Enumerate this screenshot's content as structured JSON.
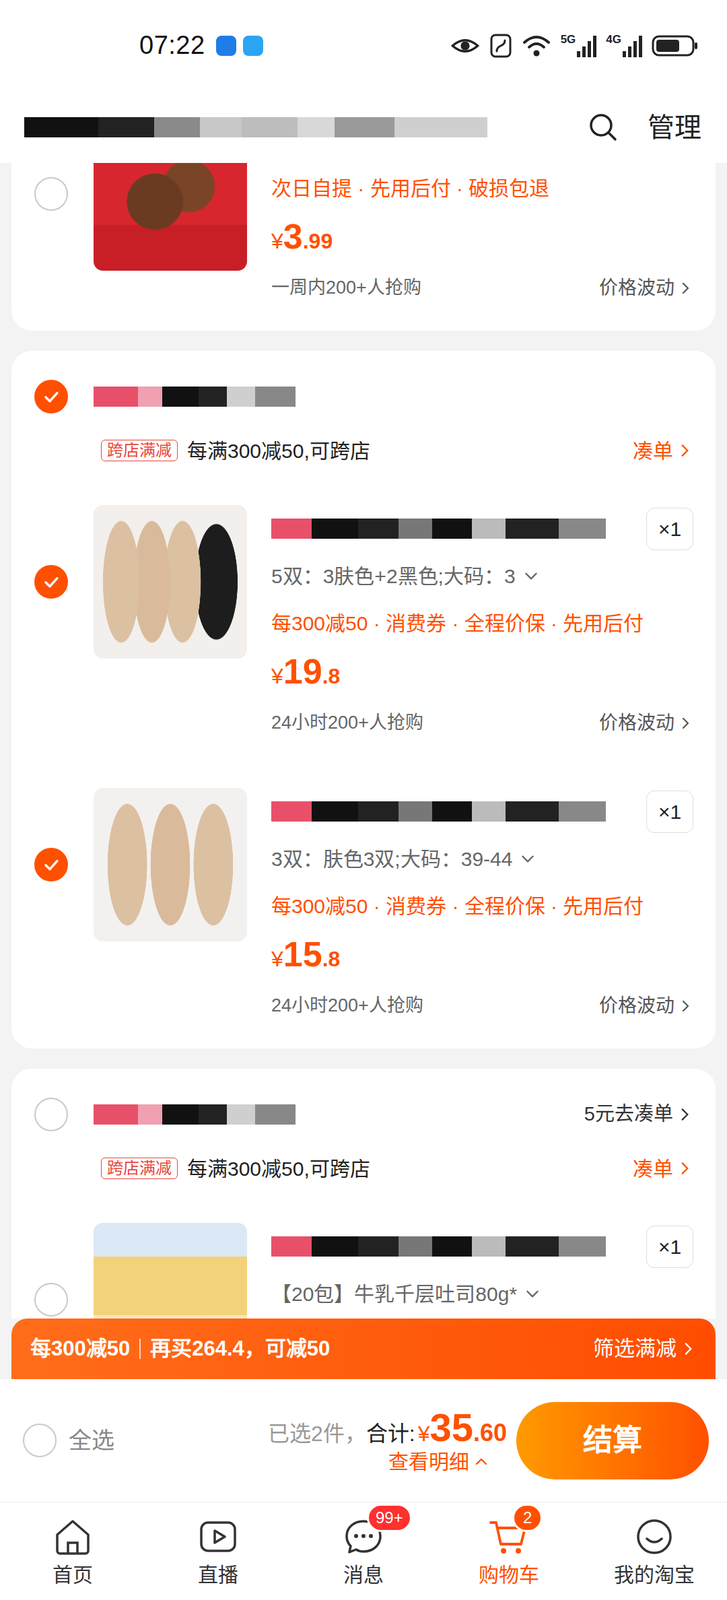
{
  "status_bar": {
    "time": "07:22",
    "signals": [
      "5G",
      "4G"
    ]
  },
  "header": {
    "manage": "管理"
  },
  "top_item": {
    "checked": false,
    "service": "次日自提 · 先用后付 · 破损包退",
    "currency": "¥",
    "price_int": "3",
    "price_dec": ".99",
    "sales": "一周内200+人抢购",
    "price_trend": "价格波动"
  },
  "shops": [
    {
      "checked": true,
      "promo_tag": "跨店满减",
      "promo_text": "每满300减50,可跨店",
      "promo_action": "凑单",
      "items": [
        {
          "checked": true,
          "quantity": "×1",
          "sku": "5双：3肤色+2黑色;大码：3",
          "promos": "每300减50 · 消费券 · 全程价保 · 先用后付",
          "currency": "¥",
          "price_int": "19",
          "price_dec": ".8",
          "sales": "24小时200+人抢购",
          "price_trend": "价格波动"
        },
        {
          "checked": true,
          "quantity": "×1",
          "sku": "3双：肤色3双;大码：39-44",
          "promos": "每300减50 · 消费券 · 全程价保 · 先用后付",
          "currency": "¥",
          "price_int": "15",
          "price_dec": ".8",
          "sales": "24小时200+人抢购",
          "price_trend": "价格波动"
        }
      ]
    },
    {
      "checked": false,
      "link": "5元去凑单",
      "promo_tag": "跨店满减",
      "promo_text": "每满300减50,可跨店",
      "promo_action": "凑单",
      "items": [
        {
          "checked": false,
          "quantity": "×1",
          "sku": "【20包】牛乳千层吐司80g*"
        }
      ]
    }
  ],
  "promo_bar": {
    "label": "每300减50",
    "text": "再买264.4，可减50",
    "action": "筛选满减"
  },
  "checkout": {
    "select_all_checked": false,
    "select_all": "全选",
    "selected_count": "已选2件，",
    "total_label": "合计:",
    "currency": "¥",
    "total_int": "35",
    "total_dec": ".60",
    "details": "查看明细",
    "submit": "结算"
  },
  "tabs": [
    {
      "label": "首页",
      "selected": false
    },
    {
      "label": "直播",
      "selected": false
    },
    {
      "label": "消息",
      "selected": false,
      "badge": "99+"
    },
    {
      "label": "购物车",
      "selected": true,
      "badge": "2"
    },
    {
      "label": "我的淘宝",
      "selected": false
    }
  ]
}
